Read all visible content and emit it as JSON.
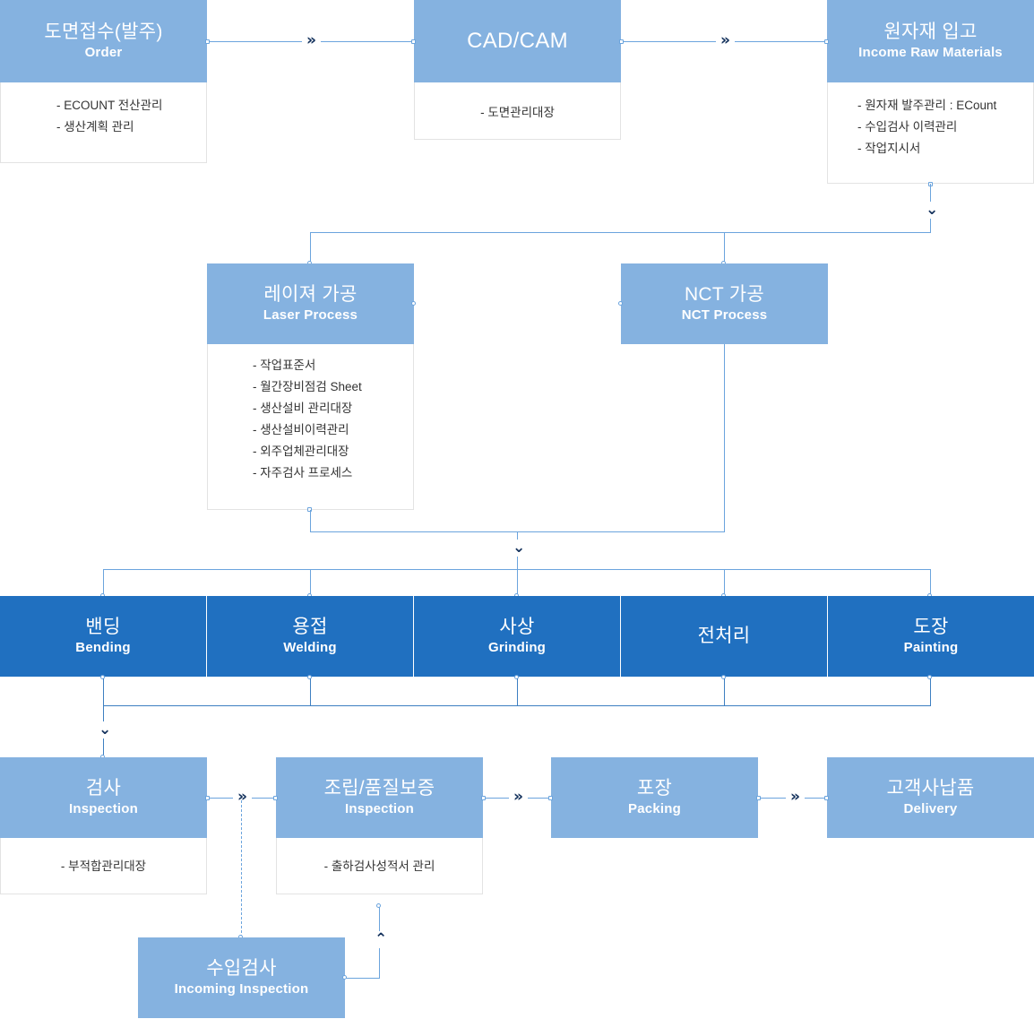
{
  "diagram": {
    "title": "Manufacturing Process Flow",
    "colors": {
      "light_blue": "#85b2e0",
      "dark_blue": "#2070c0",
      "connector": "#6ba4dd",
      "chevron": "#13315c",
      "detail_text": "#333333",
      "detail_border": "#e3e3e3"
    }
  },
  "nodes": {
    "order": {
      "kr": "도면접수(발주)",
      "en": "Order",
      "details": [
        "- ECOUNT 전산관리",
        "- 생산계획 관리"
      ]
    },
    "cadcam": {
      "kr": "CAD/CAM",
      "en": "",
      "details": [
        "- 도면관리대장"
      ]
    },
    "raw": {
      "kr": "원자재 입고",
      "en": "Income Raw Materials",
      "details": [
        "- 원자재 발주관리 : ECount",
        "- 수입검사 이력관리",
        "- 작업지시서"
      ]
    },
    "laser": {
      "kr": "레이져 가공",
      "en": "Laser Process",
      "details": [
        "- 작업표준서",
        "- 월간장비점검 Sheet",
        "- 생산설비 관리대장",
        "- 생산설비이력관리",
        "- 외주업체관리대장",
        "- 자주검사 프로세스"
      ]
    },
    "nct": {
      "kr": "NCT 가공",
      "en": "NCT Process",
      "details": []
    },
    "bending": {
      "kr": "밴딩",
      "en": "Bending",
      "details": []
    },
    "welding": {
      "kr": "용접",
      "en": "Welding",
      "details": []
    },
    "grinding": {
      "kr": "사상",
      "en": "Grinding",
      "details": []
    },
    "pretreat": {
      "kr": "전처리",
      "en": "",
      "details": []
    },
    "painting": {
      "kr": "도장",
      "en": "Painting",
      "details": []
    },
    "inspection": {
      "kr": "검사",
      "en": "Inspection",
      "details": [
        "- 부적합관리대장"
      ]
    },
    "assembly": {
      "kr": "조립/품질보증",
      "en": "Inspection",
      "details": [
        "- 출하검사성적서 관리"
      ]
    },
    "packing": {
      "kr": "포장",
      "en": "Packing",
      "details": []
    },
    "delivery": {
      "kr": "고객사납품",
      "en": "Delivery",
      "details": []
    },
    "incoming": {
      "kr": "수입검사",
      "en": "Incoming Inspection",
      "details": []
    }
  },
  "connectors": {
    "arrow_right": "»",
    "arrow_down": "⌄",
    "arrow_up": "⌃"
  }
}
